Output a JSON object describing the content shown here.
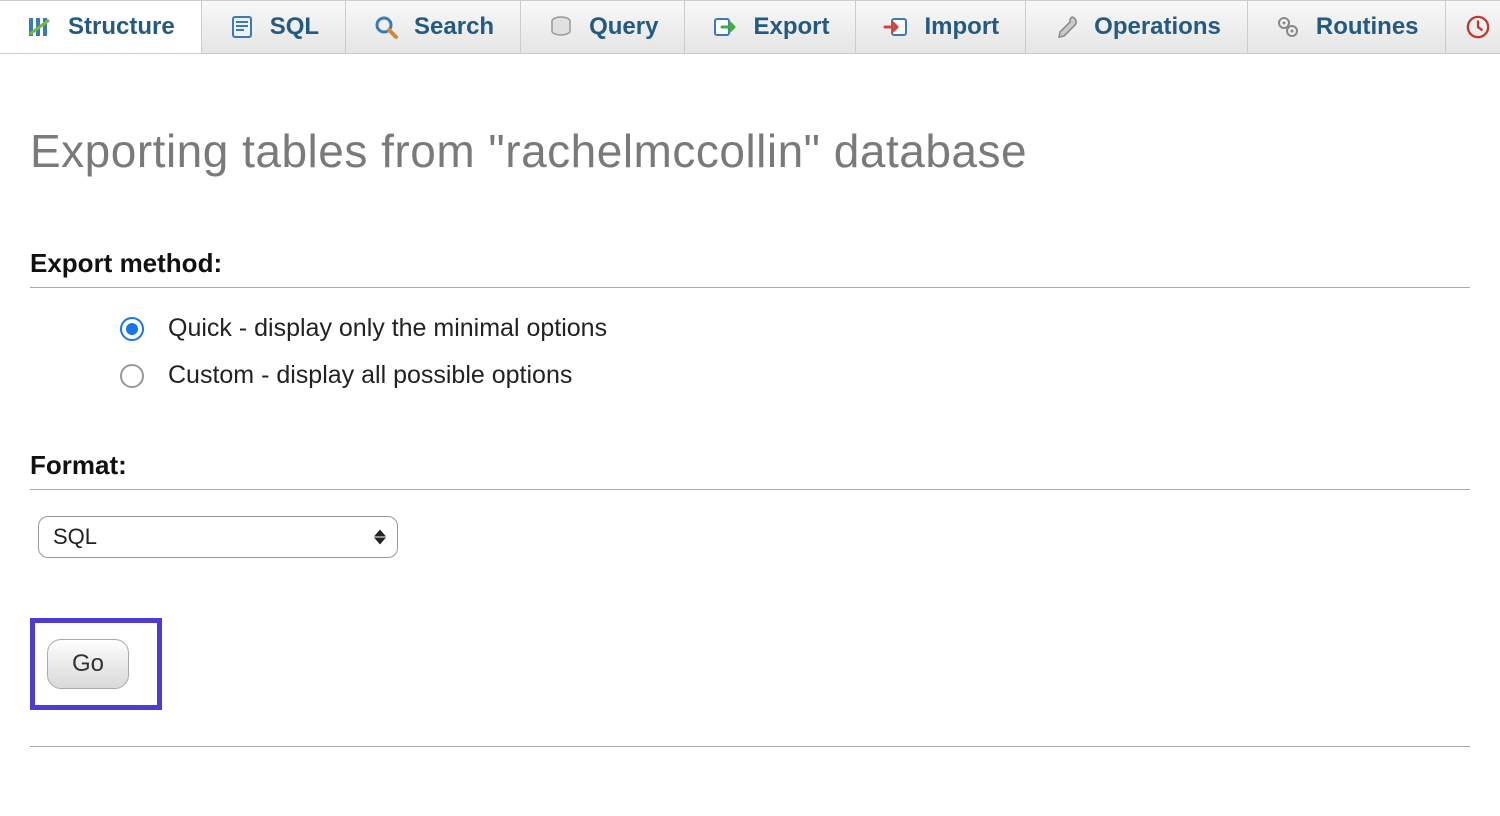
{
  "tabs": {
    "structure": {
      "label": "Structure"
    },
    "sql": {
      "label": "SQL"
    },
    "search": {
      "label": "Search"
    },
    "query": {
      "label": "Query"
    },
    "export": {
      "label": "Export"
    },
    "import": {
      "label": "Import"
    },
    "operations": {
      "label": "Operations"
    },
    "routines": {
      "label": "Routines"
    }
  },
  "page": {
    "title": "Exporting tables from \"rachelmccollin\" database"
  },
  "export_method": {
    "header": "Export method:",
    "options": {
      "quick": {
        "label": "Quick - display only the minimal options",
        "checked": true
      },
      "custom": {
        "label": "Custom - display all possible options",
        "checked": false
      }
    }
  },
  "format": {
    "header": "Format:",
    "selected": "SQL"
  },
  "actions": {
    "go_label": "Go"
  }
}
